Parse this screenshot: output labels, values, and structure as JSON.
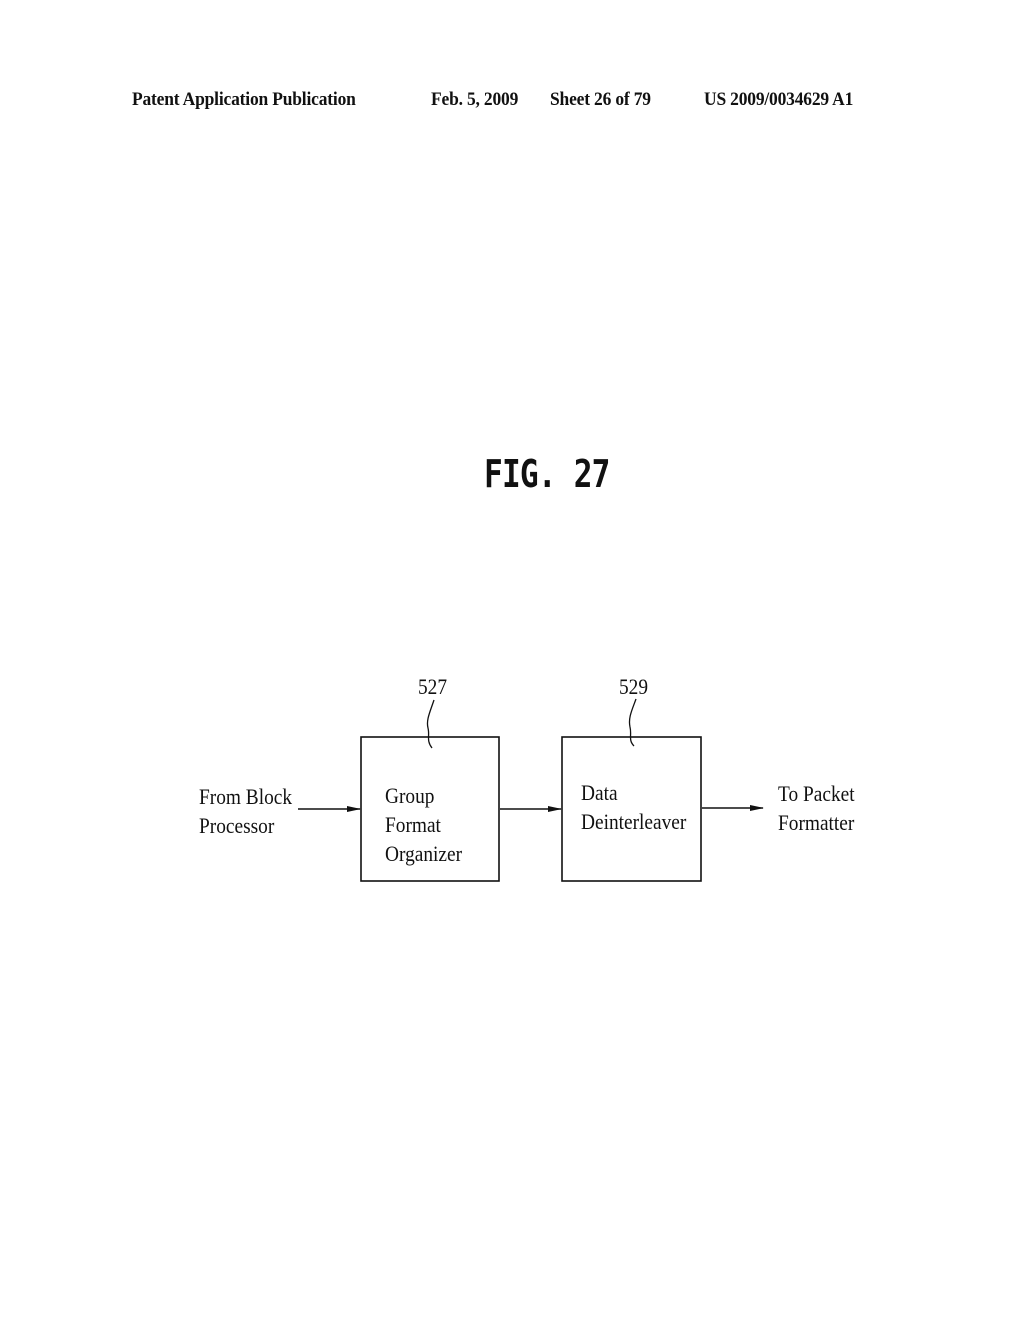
{
  "header": {
    "publication": "Patent Application Publication",
    "date": "Feb. 5, 2009",
    "sheet": "Sheet 26 of 79",
    "number": "US 2009/0034629 A1"
  },
  "figure": {
    "title": "FIG. 27",
    "input": {
      "line1": "From Block",
      "line2": "Processor"
    },
    "blocks": [
      {
        "ref": "527",
        "lines": [
          "Group",
          "Format",
          "Organizer"
        ]
      },
      {
        "ref": "529",
        "lines": [
          "Data",
          "Deinterleaver"
        ]
      }
    ],
    "output": {
      "line1": "To Packet",
      "line2": "Formatter"
    }
  }
}
